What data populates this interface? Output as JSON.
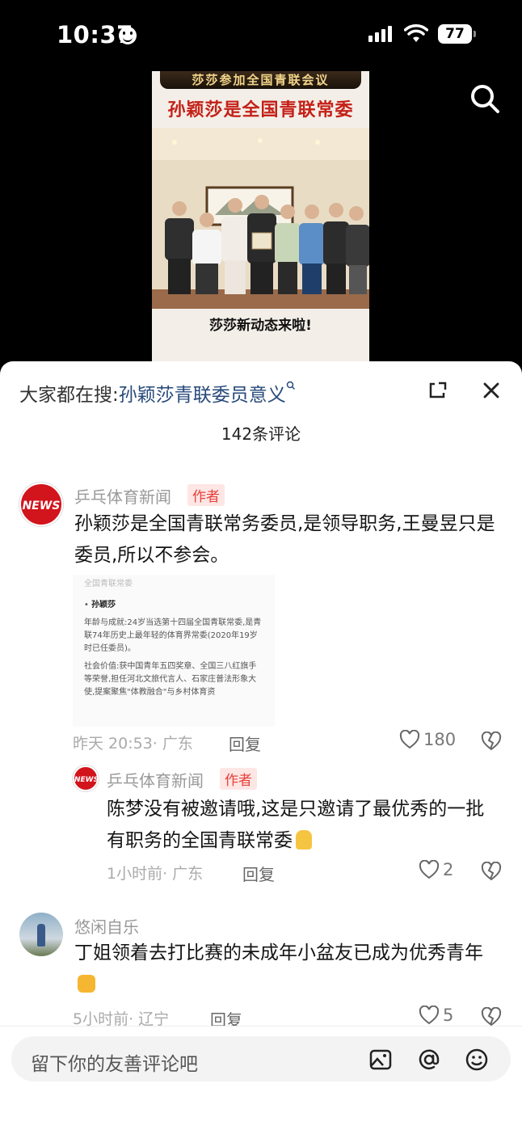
{
  "status_bar": {
    "time": "10:37",
    "battery": "77"
  },
  "video": {
    "banner": "莎莎参加全国青联会议",
    "headline": "孙颖莎是全国青联常委",
    "caption": "莎莎新动态来啦!"
  },
  "sheet": {
    "search_hint_prefix": "大家都在搜:",
    "search_hint_keyword": "孙颖莎青联委员意义",
    "comment_count": "142条评论"
  },
  "comments": [
    {
      "user": "乒乓体育新闻",
      "avatar_text": "NEWS",
      "author_tag": "作者",
      "text": "孙颖莎是全国青联常务委员,是领导职务,王曼昱只是委员,所以不参会。",
      "image": {
        "title": "全国青联常委",
        "name": "孙颖莎",
        "lines": [
          "年龄与成就:24岁当选第十四届全国青联常委,是青联74年历史上最年轻的体育界常委(2020年19岁时已任委员)。",
          "社会价值:获中国青年五四奖章、全国三八红旗手等荣誉,担任河北文旅代言人、石家庄普法形象大使,提案聚焦\"体教融合\"与乡村体育资"
        ]
      },
      "time": "昨天 20:53",
      "location": "· 广东",
      "reply_label": "回复",
      "likes": "180",
      "replies": [
        {
          "user": "乒乓体育新闻",
          "avatar_text": "NEWS",
          "author_tag": "作者",
          "text": "陈梦没有被邀请哦,这是只邀请了最优秀的一批有职务的全国青联常委",
          "time": "1小时前",
          "location": "· 广东",
          "reply_label": "回复",
          "likes": "2"
        }
      ]
    },
    {
      "user": "悠闲自乐",
      "text": "丁姐领着去打比赛的未成年小盆友已成为优秀青年",
      "time": "5小时前",
      "location": "· 辽宁",
      "reply_label": "回复",
      "likes": "5"
    }
  ],
  "input": {
    "placeholder": "留下你的友善评论吧"
  },
  "icons": {
    "search": "search-icon",
    "expand": "expand-icon",
    "close": "close-icon",
    "like": "heart-icon",
    "dislike": "broken-heart-icon",
    "image": "image-icon",
    "mention": "at-icon",
    "emoji": "emoji-icon"
  },
  "colors": {
    "accent_red": "#e8403a",
    "keyword_blue": "#274a7a",
    "headline_red": "#c42018"
  }
}
